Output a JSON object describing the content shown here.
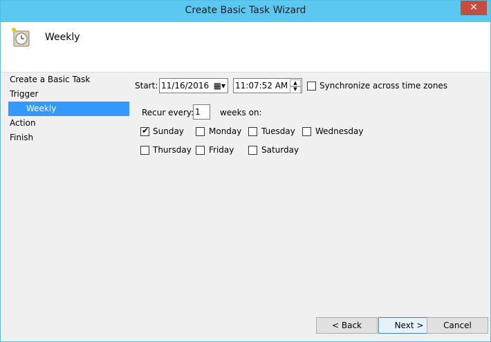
{
  "window": {
    "title": "Create Basic Task Wizard",
    "close_glyph": "✕"
  },
  "header": {
    "title": "Weekly",
    "icon": "clock-icon"
  },
  "nav": {
    "items": [
      {
        "label": "Create a Basic Task"
      },
      {
        "label": "Trigger"
      },
      {
        "label": "Weekly"
      },
      {
        "label": "Action"
      },
      {
        "label": "Finish"
      }
    ]
  },
  "form": {
    "start_label": "Start:",
    "start_date": "11/16/2016",
    "start_time": "11:07:52 AM",
    "sync_label": "Synchronize across time zones",
    "sync_checked": false,
    "recur_label": "Recur every:",
    "recur_value": "1",
    "recur_suffix": "weeks on:",
    "days": [
      {
        "label": "Sunday",
        "checked": true
      },
      {
        "label": "Monday",
        "checked": false
      },
      {
        "label": "Tuesday",
        "checked": false
      },
      {
        "label": "Wednesday",
        "checked": false
      },
      {
        "label": "Thursday",
        "checked": false
      },
      {
        "label": "Friday",
        "checked": false
      },
      {
        "label": "Saturday",
        "checked": false
      }
    ]
  },
  "buttons": {
    "back": "< Back",
    "next": "Next >",
    "cancel": "Cancel"
  }
}
